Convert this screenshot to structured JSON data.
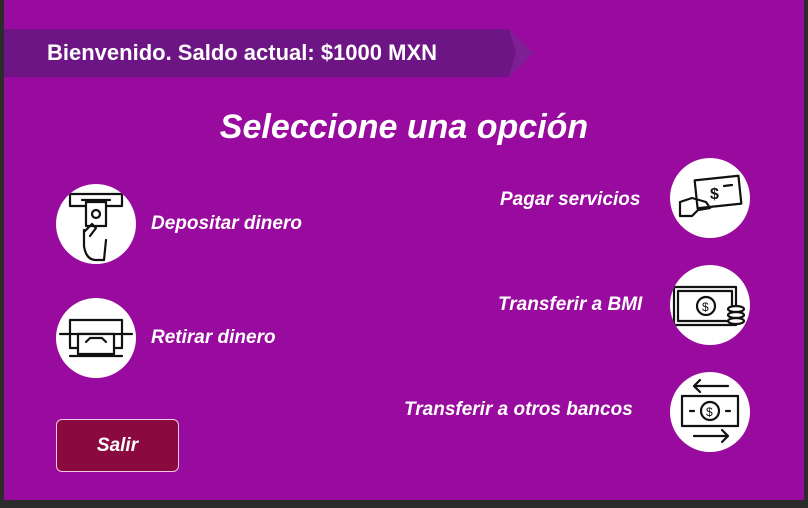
{
  "header": {
    "balance_text": "Bienvenido. Saldo actual: $1000 MXN"
  },
  "main": {
    "title": "Seleccione una opción",
    "options": [
      {
        "label": "Depositar dinero",
        "icon": "deposit-atm-icon"
      },
      {
        "label": "Retirar dinero",
        "icon": "withdraw-atm-icon"
      },
      {
        "label": "Pagar servicios",
        "icon": "pay-bill-hand-icon"
      },
      {
        "label": "Transferir a BMI",
        "icon": "cash-coins-icon"
      },
      {
        "label": "Transferir a otros bancos",
        "icon": "money-exchange-arrows-icon"
      }
    ],
    "exit_label": "Salir"
  },
  "colors": {
    "background": "#990a9e",
    "banner": "#6e1585",
    "exit_button": "#8a0a40",
    "text": "#ffffff"
  }
}
